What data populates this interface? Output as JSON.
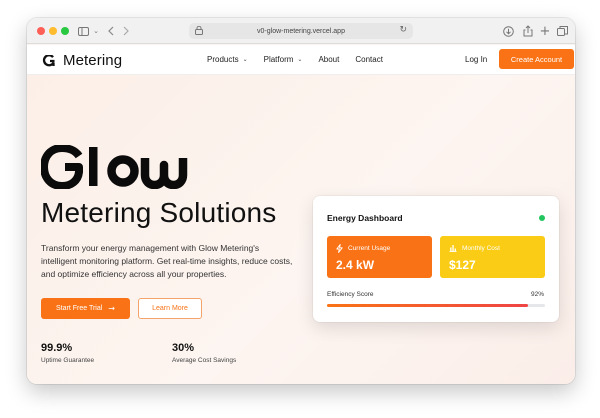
{
  "browser": {
    "url": "v0-glow-metering.vercel.app"
  },
  "nav": {
    "brand": "Metering",
    "items": [
      {
        "label": "Products",
        "has_dropdown": true
      },
      {
        "label": "Platform",
        "has_dropdown": true
      },
      {
        "label": "About",
        "has_dropdown": false
      },
      {
        "label": "Contact",
        "has_dropdown": false
      }
    ],
    "login_label": "Log In",
    "cta_label": "Create Account"
  },
  "hero": {
    "logo_word": "Glow",
    "subtitle": "Metering Solutions",
    "description": "Transform your energy management with Glow Metering's intelligent monitoring platform. Get real-time insights, reduce costs, and optimize efficiency across all your properties.",
    "primary_button": "Start Free Trial",
    "secondary_button": "Learn More",
    "stats": [
      {
        "value": "99.9%",
        "label": "Uptime Guarantee"
      },
      {
        "value": "30%",
        "label": "Average Cost Savings"
      }
    ]
  },
  "dashboard": {
    "title": "Energy Dashboard",
    "status": "online",
    "tiles": [
      {
        "label": "Current Usage",
        "value": "2.4 kW",
        "icon": "lightning-icon",
        "color": "#f97316"
      },
      {
        "label": "Monthly Cost",
        "value": "$127",
        "icon": "bar-chart-icon",
        "color": "#facc15"
      }
    ],
    "efficiency_label": "Efficiency Score",
    "efficiency_value": "92%",
    "efficiency_fraction": 0.92
  },
  "colors": {
    "accent": "#f97316",
    "accent_yellow": "#facc15",
    "status_green": "#22c55e"
  }
}
